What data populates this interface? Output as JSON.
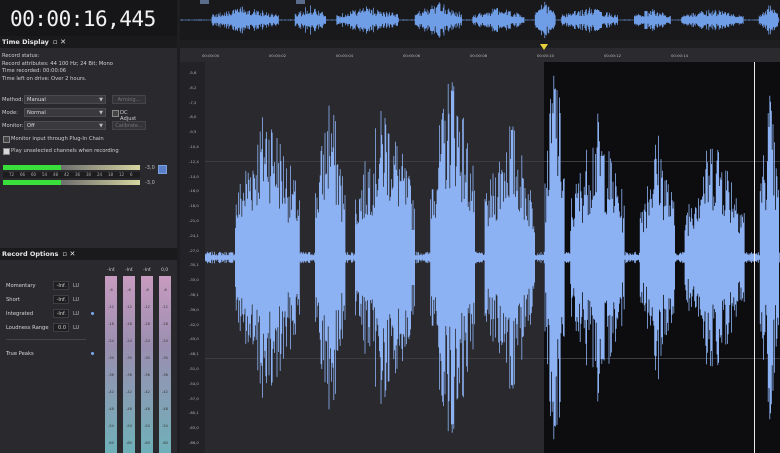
{
  "time_display": {
    "timecode": "00:00:16,445"
  },
  "record_panel": {
    "title": "Time Display",
    "lines": [
      "Record status:",
      "Record attributes: 44 100 Hz; 24 Bit; Mono",
      "Time recorded: 00:00:06",
      "Time left on drive: Over 2 hours."
    ],
    "method_label": "Method:",
    "method_value": "Manual",
    "mode_label": "Mode:",
    "mode_value": "Normal",
    "monitor_label": "Monitor:",
    "monitor_value": "Off",
    "arming_button": "Arming...",
    "calibrate_button": "Calibrate...",
    "dc_adjust": "DC Adjust",
    "monitor_plugin": "Monitor input through Plug-In Chain",
    "play_unselected": "Play unselected channels when recording",
    "meter_scale": [
      "72",
      "66",
      "60",
      "54",
      "48",
      "42",
      "36",
      "30",
      "24",
      "18",
      "12",
      "6"
    ],
    "meter_values": [
      "-3,0",
      "-3,0"
    ],
    "meter_levels": [
      0.42,
      0.42
    ]
  },
  "loudness_panel": {
    "title": "Record Options",
    "rows": [
      {
        "label": "Momentary",
        "value": "-Inf.",
        "unit": "LU"
      },
      {
        "label": "Short",
        "value": "-Inf.",
        "unit": "LU"
      },
      {
        "label": "Integrated",
        "value": "-Inf.",
        "unit": "LU"
      },
      {
        "label": "Loudness Range",
        "value": "0.0",
        "unit": "LU"
      }
    ],
    "true_peaks": "True Peaks",
    "meter_tops": [
      "-Inf.",
      "-Inf.",
      "-Inf.",
      "0,0"
    ],
    "meter_ticks": [
      "-6",
      "-12",
      "-18",
      "-24",
      "-30",
      "-36",
      "-42",
      "-48",
      "-54",
      "-60"
    ]
  },
  "ruler": {
    "ticks": [
      "00:00:00",
      "00:00:02",
      "00:00:04",
      "00:00:06",
      "00:00:08",
      "00:00:10",
      "00:00:12",
      "00:00:14"
    ]
  },
  "vruler": {
    "ticks": [
      "-5,6",
      "-6,2",
      "-7,2",
      "-8,0",
      "-9,5",
      "-10,4",
      "-12,4",
      "-14,0",
      "-16,0",
      "-18,0",
      "-21,0",
      "-24,1",
      "-27,0",
      "-30,1",
      "-33,0",
      "-36,1",
      "-39,0",
      "-42,0",
      "-45,0",
      "-48,1",
      "-51,0",
      "-54,0",
      "-57,0",
      "-60,1",
      "-63,0",
      "-66,0"
    ]
  }
}
